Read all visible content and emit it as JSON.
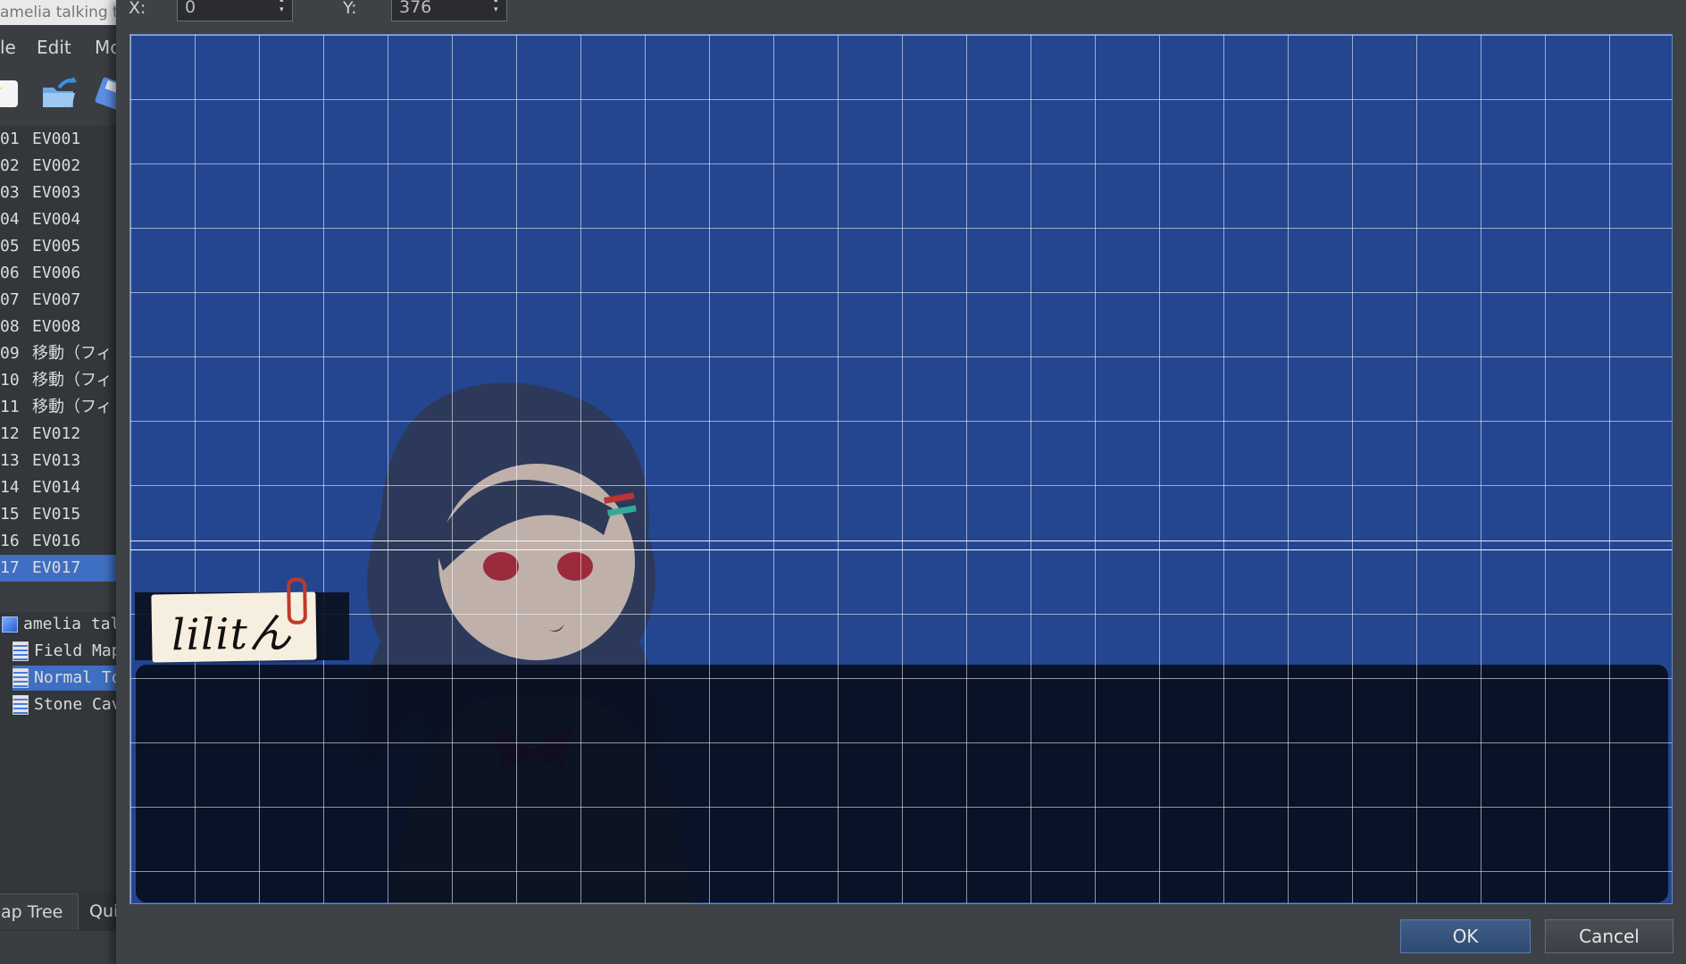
{
  "main_window": {
    "title": "amelia talking t",
    "menu": [
      "le",
      "Edit",
      "Mc"
    ],
    "toolbar": [
      "new-file-icon",
      "open-folder-icon",
      "save-icon"
    ],
    "events": [
      {
        "num": "01",
        "name": "EV001"
      },
      {
        "num": "02",
        "name": "EV002"
      },
      {
        "num": "03",
        "name": "EV003"
      },
      {
        "num": "04",
        "name": "EV004"
      },
      {
        "num": "05",
        "name": "EV005"
      },
      {
        "num": "06",
        "name": "EV006"
      },
      {
        "num": "07",
        "name": "EV007"
      },
      {
        "num": "08",
        "name": "EV008"
      },
      {
        "num": "09",
        "name": "移動（フィ"
      },
      {
        "num": "10",
        "name": "移動（フィ"
      },
      {
        "num": "11",
        "name": "移動（フィ"
      },
      {
        "num": "12",
        "name": "EV012"
      },
      {
        "num": "13",
        "name": "EV013"
      },
      {
        "num": "14",
        "name": "EV014"
      },
      {
        "num": "15",
        "name": "EV015"
      },
      {
        "num": "16",
        "name": "EV016"
      },
      {
        "num": "17",
        "name": "EV017"
      }
    ],
    "selected_event": "17",
    "map_tree": [
      {
        "label": "amelia tal",
        "type": "project"
      },
      {
        "label": "Field Map",
        "type": "map"
      },
      {
        "label": "Normal To",
        "type": "map",
        "selected": true
      },
      {
        "label": "Stone Cav",
        "type": "map"
      }
    ],
    "tabs": [
      "ap Tree",
      "Qui"
    ]
  },
  "dialog": {
    "x_label": "X:",
    "x_value": "0",
    "y_label": "Y:",
    "y_value": "376",
    "preview": {
      "name_plate_text": "lilitん",
      "background_color": "#244690"
    },
    "ok_label": "OK",
    "cancel_label": "Cancel"
  }
}
